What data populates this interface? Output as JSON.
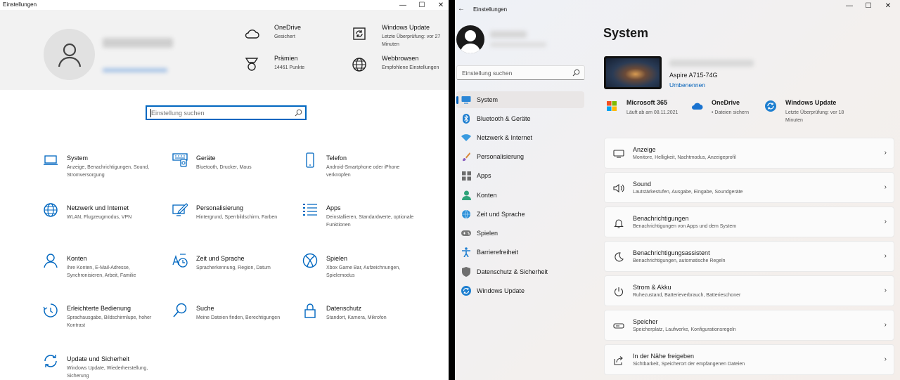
{
  "colors": {
    "accent": "#0067c0",
    "win11_accent": "#005fb8"
  },
  "win10": {
    "window_title": "Einstellungen",
    "header_items": [
      {
        "title": "OneDrive",
        "subtitle": "Gesichert",
        "icon": "cloud-icon"
      },
      {
        "title": "Windows Update",
        "subtitle": "Letzte Überprüfung: vor 27 Minuten",
        "icon": "windows-update-icon"
      },
      {
        "title": "Prämien",
        "subtitle": "14461 Punkte",
        "icon": "medal-icon"
      },
      {
        "title": "Webbrowsen",
        "subtitle": "Empfohlene Einstellungen",
        "icon": "globe-icon"
      }
    ],
    "search": {
      "placeholder": "Einstellung suchen"
    },
    "tiles": [
      {
        "title": "System",
        "subtitle": "Anzeige, Benachrichtigungen, Sound, Stromversorgung",
        "icon": "laptop-icon"
      },
      {
        "title": "Geräte",
        "subtitle": "Bluetooth, Drucker, Maus",
        "icon": "devices-icon"
      },
      {
        "title": "Telefon",
        "subtitle": "Android-Smartphone oder iPhone verknüpfen",
        "icon": "phone-icon"
      },
      {
        "title": "Netzwerk und Internet",
        "subtitle": "WLAN, Flugzeugmodus, VPN",
        "icon": "globe-icon"
      },
      {
        "title": "Personalisierung",
        "subtitle": "Hintergrund, Sperrbildschirm, Farben",
        "icon": "personalize-icon"
      },
      {
        "title": "Apps",
        "subtitle": "Deinstallieren, Standardwerte, optionale Funktionen",
        "icon": "apps-list-icon"
      },
      {
        "title": "Konten",
        "subtitle": "Ihre Konten, E-Mail-Adresse, Synchronisieren, Arbeit, Familie",
        "icon": "person-icon"
      },
      {
        "title": "Zeit und Sprache",
        "subtitle": "Spracherkennung, Region, Datum",
        "icon": "time-language-icon"
      },
      {
        "title": "Spielen",
        "subtitle": "Xbox Game Bar, Aufzeichnungen, Spielemodus",
        "icon": "xbox-icon"
      },
      {
        "title": "Erleichterte Bedienung",
        "subtitle": "Sprachausgabe, Bildschirmlupe, hoher Kontrast",
        "icon": "accessibility-timer-icon"
      },
      {
        "title": "Suche",
        "subtitle": "Meine Dateien finden, Berechtigungen",
        "icon": "search-icon"
      },
      {
        "title": "Datenschutz",
        "subtitle": "Standort, Kamera, Mikrofon",
        "icon": "lock-icon"
      },
      {
        "title": "Update und Sicherheit",
        "subtitle": "Windows Update, Wiederherstellung, Sicherung",
        "icon": "sync-icon"
      }
    ]
  },
  "win11": {
    "window_title": "Einstellungen",
    "search": {
      "placeholder": "Einstellung suchen"
    },
    "nav": [
      {
        "label": "System",
        "icon": "monitor-icon",
        "active": true
      },
      {
        "label": "Bluetooth & Geräte",
        "icon": "bluetooth-icon"
      },
      {
        "label": "Netzwerk & Internet",
        "icon": "wifi-icon"
      },
      {
        "label": "Personalisierung",
        "icon": "brush-icon"
      },
      {
        "label": "Apps",
        "icon": "apps-icon"
      },
      {
        "label": "Konten",
        "icon": "person-icon"
      },
      {
        "label": "Zeit und Sprache",
        "icon": "globe-clock-icon"
      },
      {
        "label": "Spielen",
        "icon": "gamepad-icon"
      },
      {
        "label": "Barrierefreiheit",
        "icon": "accessibility-icon"
      },
      {
        "label": "Datenschutz & Sicherheit",
        "icon": "shield-icon"
      },
      {
        "label": "Windows Update",
        "icon": "windows-update-icon"
      }
    ],
    "page_title": "System",
    "device": {
      "model": "Aspire A715-74G",
      "rename": "Umbenennen"
    },
    "quick_status": [
      {
        "title": "Microsoft 365",
        "subtitle": "Läuft ab am 08.11.2021",
        "icon": "microsoft-logo-icon"
      },
      {
        "title": "OneDrive",
        "subtitle": "• Dateien sichern",
        "icon": "cloud-icon"
      },
      {
        "title": "Windows Update",
        "subtitle": "Letzte Überprüfung: vor 18 Minuten",
        "icon": "windows-update-icon"
      }
    ],
    "cards": [
      {
        "title": "Anzeige",
        "subtitle": "Monitore, Helligkeit, Nachtmodus, Anzeigeprofil",
        "icon": "display-icon"
      },
      {
        "title": "Sound",
        "subtitle": "Lautstärkestufen, Ausgabe, Eingabe, Soundgeräte",
        "icon": "speaker-icon"
      },
      {
        "title": "Benachrichtigungen",
        "subtitle": "Benachrichtigungen von Apps und dem System",
        "icon": "bell-icon"
      },
      {
        "title": "Benachrichtigungsassistent",
        "subtitle": "Benachrichtigungen, automatische Regeln",
        "icon": "moon-icon"
      },
      {
        "title": "Strom & Akku",
        "subtitle": "Ruhezustand, Batterieverbrauch, Batterieschoner",
        "icon": "power-icon"
      },
      {
        "title": "Speicher",
        "subtitle": "Speicherplatz, Laufwerke, Konfigurationsregeln",
        "icon": "storage-icon"
      },
      {
        "title": "In der Nähe freigeben",
        "subtitle": "Sichtbarkeit, Speicherort der empfangenen Dateien",
        "icon": "share-icon"
      }
    ]
  }
}
